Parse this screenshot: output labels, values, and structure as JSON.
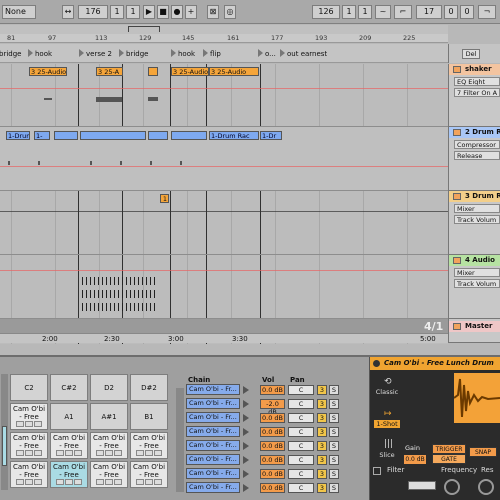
{
  "transport": {
    "left_select": "None",
    "position": "176",
    "pos_beat": "1",
    "pos_sub": "1",
    "loop_start": "126",
    "loop_beat": "1",
    "loop_sub": "1",
    "loop_len": "17",
    "loop_len_beat": "0",
    "loop_len_sub": "0"
  },
  "ruler": [
    "81",
    "97",
    "113",
    "129",
    "145",
    "161",
    "177",
    "193",
    "209",
    "225"
  ],
  "locators": [
    "bridge",
    "hook",
    "verse 2",
    "bridge",
    "hook",
    "flip",
    "o...",
    "out earnest"
  ],
  "clips": {
    "shaker": [
      "3 25-Audio",
      "3 25-A",
      "3 25-Audio",
      "3 25-Audio"
    ],
    "drum2": [
      "1-Drum",
      "1-",
      "1-Drum Rac",
      "1-Dr"
    ],
    "drum3_marker": "1"
  },
  "tracks": {
    "shaker": {
      "name": "shaker",
      "device": "EQ Eight",
      "param": "7 Filter On A"
    },
    "drum2": {
      "name": "2 Drum R",
      "device": "Compressor",
      "param": "Release"
    },
    "drum3": {
      "name": "3 Drum R",
      "device": "Mixer",
      "param": "Track Volum"
    },
    "audio4": {
      "name": "4 Audio",
      "device": "Mixer",
      "param": "Track Volum"
    },
    "master": {
      "name": "Master"
    }
  },
  "delete_button": "Del",
  "meter": "4/1",
  "timeline": [
    "2:00",
    "2:30",
    "3:00",
    "3:30",
    "5:00"
  ],
  "pads": [
    {
      "label": "C2"
    },
    {
      "label": "C#2"
    },
    {
      "label": "D2"
    },
    {
      "label": "D#2"
    },
    {
      "label": "Cam O'bi - Free"
    },
    {
      "label": "A1"
    },
    {
      "label": "A#1"
    },
    {
      "label": "B1"
    },
    {
      "label": "Cam O'bi - Free"
    },
    {
      "label": "Cam O'bi - Free"
    },
    {
      "label": "Cam O'bi - Free"
    },
    {
      "label": "Cam O'bi - Free"
    },
    {
      "label": "Cam O'bi - Free"
    },
    {
      "label": "Cam O'bi - Free"
    },
    {
      "label": "Cam O'bi - Free"
    },
    {
      "label": "Cam O'bi - Free"
    }
  ],
  "chain_headers": {
    "chain": "Chain",
    "vol": "Vol",
    "pan": "Pan"
  },
  "chains": [
    {
      "name": "Cam O'bi - Fr...",
      "vol": "0.0 dB",
      "pan": "C"
    },
    {
      "name": "Cam O'bi - Fr...",
      "vol": "-2.0 dB",
      "pan": "C"
    },
    {
      "name": "Cam O'bi - Fr...",
      "vol": "0.0 dB",
      "pan": "C"
    },
    {
      "name": "Cam O'bi - Fr...",
      "vol": "0.0 dB",
      "pan": "C"
    },
    {
      "name": "Cam O'bi - Fr...",
      "vol": "0.0 dB",
      "pan": "C"
    },
    {
      "name": "Cam O'bi - Fr...",
      "vol": "0.0 dB",
      "pan": "C"
    },
    {
      "name": "Cam O'bi - Fr...",
      "vol": "0.0 dB",
      "pan": "C"
    },
    {
      "name": "Cam O'bi - Fr...",
      "vol": "0.0 dB",
      "pan": "C"
    }
  ],
  "simpler": {
    "title": "Cam O'bi - Free Lunch Drum",
    "modes": [
      "Classic",
      "1-Shot",
      "Slice"
    ],
    "gain_label": "Gain",
    "gain_value": "0.0 dB",
    "trigger": "TRIGGER",
    "gate": "GATE",
    "snap": "SNAP",
    "filter": "Filter",
    "frequency": "Frequency",
    "res": "Res"
  },
  "colors": {
    "orange": "#f5a53a",
    "blue": "#7ea9f0",
    "accent": "#f0a431"
  }
}
